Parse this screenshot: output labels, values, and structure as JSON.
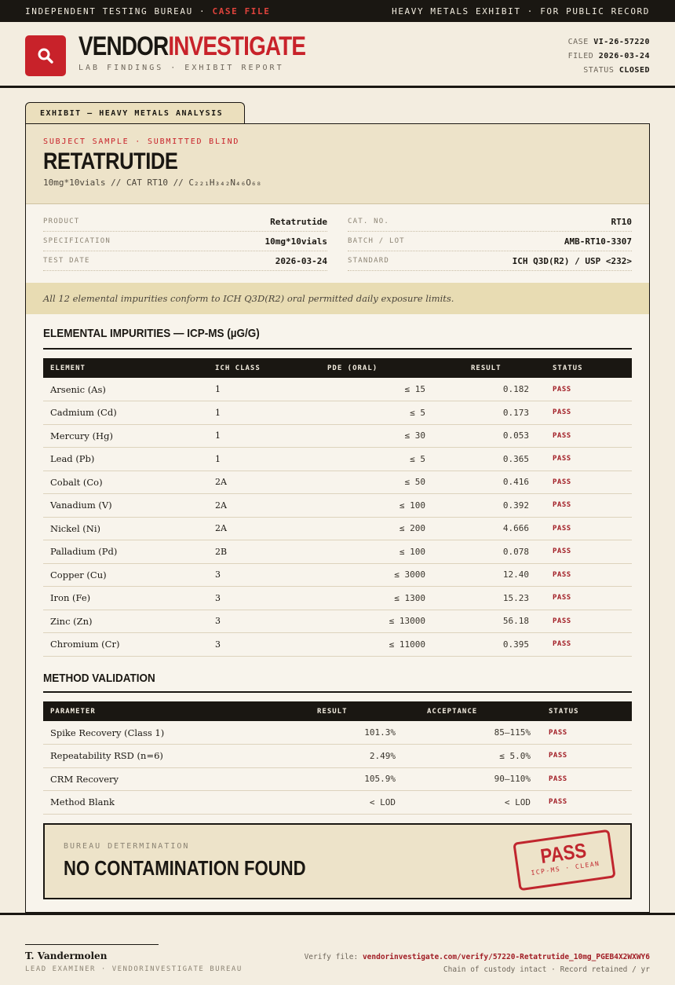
{
  "topbar": {
    "left_prefix": "INDEPENDENT TESTING BUREAU ·",
    "left_highlight": "CASE FILE",
    "right": "HEAVY METALS EXHIBIT · FOR PUBLIC RECORD"
  },
  "header": {
    "brand_part1": "VENDOR",
    "brand_part2": "INVESTIGATE",
    "tagline": "LAB FINDINGS · EXHIBIT REPORT",
    "case_label": "CASE",
    "case_value": "VI-26-57220",
    "filed_label": "FILED",
    "filed_value": "2026-03-24",
    "status_label": "STATUS",
    "status_value": "CLOSED",
    "logo_icon": "magnifier-icon"
  },
  "exhibit": {
    "tab_label": "EXHIBIT — HEAVY METALS ANALYSIS",
    "eyebrow": "SUBJECT SAMPLE · SUBMITTED BLIND",
    "name": "RETATRUTIDE",
    "subline": "10mg*10vials  //  CAT RT10  //  C₂₂₁H₃₄₂N₄₆O₆₈",
    "meta_left": [
      {
        "k": "PRODUCT",
        "v": "Retatrutide"
      },
      {
        "k": "SPECIFICATION",
        "v": "10mg*10vials"
      },
      {
        "k": "TEST DATE",
        "v": "2026-03-24"
      }
    ],
    "meta_right": [
      {
        "k": "CAT. NO.",
        "v": "RT10"
      },
      {
        "k": "BATCH / LOT",
        "v": "AMB-RT10-3307"
      },
      {
        "k": "STANDARD",
        "v": "ICH Q3D(R2) / USP <232>"
      }
    ],
    "summary": "All 12 elemental impurities conform to ICH Q3D(R2) oral permitted daily exposure limits."
  },
  "impurities": {
    "title": "ELEMENTAL IMPURITIES — ICP-MS (µG/G)",
    "headers": [
      "ELEMENT",
      "ICH CLASS",
      "PDE (ORAL)",
      "RESULT",
      "STATUS"
    ],
    "rows": [
      [
        "Arsenic (As)",
        "1",
        "≤ 15",
        "0.182",
        "PASS"
      ],
      [
        "Cadmium (Cd)",
        "1",
        "≤ 5",
        "0.173",
        "PASS"
      ],
      [
        "Mercury (Hg)",
        "1",
        "≤ 30",
        "0.053",
        "PASS"
      ],
      [
        "Lead (Pb)",
        "1",
        "≤ 5",
        "0.365",
        "PASS"
      ],
      [
        "Cobalt (Co)",
        "2A",
        "≤ 50",
        "0.416",
        "PASS"
      ],
      [
        "Vanadium (V)",
        "2A",
        "≤ 100",
        "0.392",
        "PASS"
      ],
      [
        "Nickel (Ni)",
        "2A",
        "≤ 200",
        "4.666",
        "PASS"
      ],
      [
        "Palladium (Pd)",
        "2B",
        "≤ 100",
        "0.078",
        "PASS"
      ],
      [
        "Copper (Cu)",
        "3",
        "≤ 3000",
        "12.40",
        "PASS"
      ],
      [
        "Iron (Fe)",
        "3",
        "≤ 1300",
        "15.23",
        "PASS"
      ],
      [
        "Zinc (Zn)",
        "3",
        "≤ 13000",
        "56.18",
        "PASS"
      ],
      [
        "Chromium (Cr)",
        "3",
        "≤ 11000",
        "0.395",
        "PASS"
      ]
    ]
  },
  "validation": {
    "title": "METHOD VALIDATION",
    "headers": [
      "PARAMETER",
      "RESULT",
      "ACCEPTANCE",
      "STATUS"
    ],
    "rows": [
      [
        "Spike Recovery (Class 1)",
        "101.3%",
        "85–115%",
        "PASS"
      ],
      [
        "Repeatability RSD (n=6)",
        "2.49%",
        "≤ 5.0%",
        "PASS"
      ],
      [
        "CRM Recovery",
        "105.9%",
        "90–110%",
        "PASS"
      ],
      [
        "Method Blank",
        "< LOD",
        "< LOD",
        "PASS"
      ]
    ]
  },
  "determination": {
    "eyebrow": "BUREAU DETERMINATION",
    "verdict": "NO CONTAMINATION FOUND",
    "stamp_main": "PASS",
    "stamp_sub": "ICP-MS · CLEAN"
  },
  "footer": {
    "signer": "T. Vandermolen",
    "role": "LEAD EXAMINER · VENDORINVESTIGATE BUREAU",
    "verify_label": "Verify file:",
    "verify_url": "vendorinvestigate.com/verify/57220-Retatrutide_10mg_PGEB4X2WXWY6",
    "custody": "Chain of custody intact · Record retained / yr"
  },
  "colors": {
    "accent_red": "#c8222a",
    "ink": "#1a1712",
    "paper": "#f3ede0",
    "panel": "#ede3c9"
  }
}
